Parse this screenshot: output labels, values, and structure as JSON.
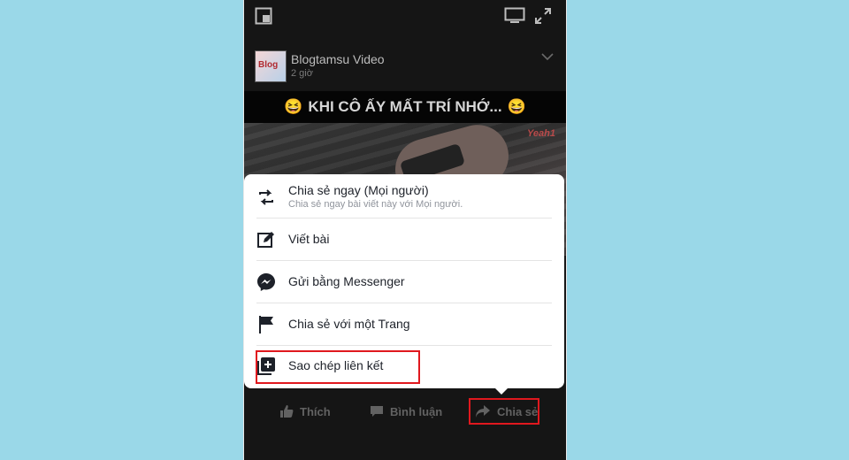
{
  "post": {
    "page_name": "Blogtamsu Video",
    "time": "2 giờ",
    "caption": "KHI CÔ ẤY MẤT TRÍ NHỚ...",
    "caption_emoji": "😆",
    "avatar_text": "Blog",
    "watermark": "Yeah1"
  },
  "share_menu": {
    "items": [
      {
        "label": "Chia sẻ ngay (Mọi người)",
        "sublabel": "Chia sẻ ngay bài viết này với Mọi người."
      },
      {
        "label": "Viết bài"
      },
      {
        "label": "Gửi bằng Messenger"
      },
      {
        "label": "Chia sẻ với một Trang"
      },
      {
        "label": "Sao chép liên kết"
      }
    ]
  },
  "actions": {
    "like": "Thích",
    "comment": "Bình luận",
    "share": "Chia sẻ"
  },
  "colors": {
    "highlight": "#e0181e",
    "background": "#9ad8e8",
    "phone": "#151515"
  }
}
